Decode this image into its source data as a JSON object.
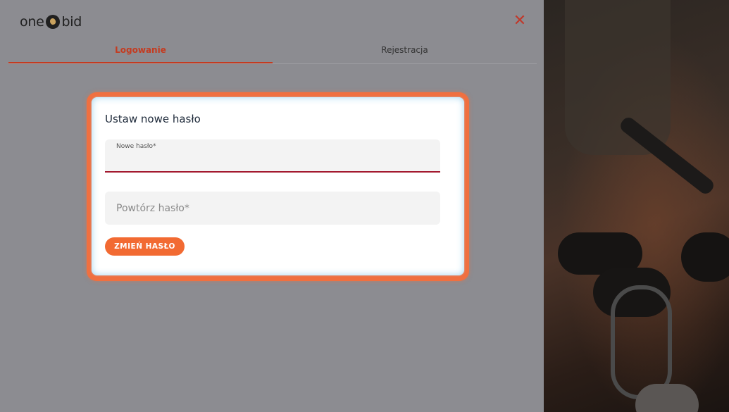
{
  "brand": {
    "logo_left": "one",
    "logo_right": "bid"
  },
  "tabs": [
    {
      "label": "Logowanie",
      "active": true
    },
    {
      "label": "Rejestracja",
      "active": false
    }
  ],
  "form": {
    "title": "Ustaw nowe hasło",
    "new_password_label": "Nowe hasło*",
    "new_password_value": "",
    "repeat_password_placeholder": "Powtórz hasło*",
    "submit_label": "ZMIEŃ HASŁO"
  },
  "colors": {
    "accent": "#f26a32",
    "active_tab": "#c43b20",
    "input_underline": "#a3192f",
    "close": "#c0392b"
  },
  "icons": {
    "close": "close-icon",
    "logo_mark": "onebid-logo-mark"
  }
}
